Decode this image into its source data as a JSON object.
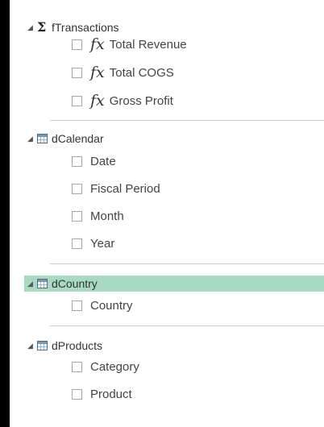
{
  "fields_pane": {
    "tables": [
      {
        "name": "fTransactions",
        "icon": "sigma-icon",
        "fields": [
          {
            "label": "Total Revenue",
            "kind": "measure",
            "icon": "fx-icon"
          },
          {
            "label": "Total COGS",
            "kind": "measure",
            "icon": "fx-icon"
          },
          {
            "label": "Gross Profit",
            "kind": "measure",
            "icon": "fx-icon"
          }
        ]
      },
      {
        "name": "dCalendar",
        "icon": "table-icon",
        "fields": [
          {
            "label": "Date",
            "kind": "column"
          },
          {
            "label": "Fiscal Period",
            "kind": "column"
          },
          {
            "label": "Month",
            "kind": "column"
          },
          {
            "label": "Year",
            "kind": "column"
          }
        ]
      },
      {
        "name": "dCountry",
        "icon": "table-icon",
        "selected": true,
        "fields": [
          {
            "label": "Country",
            "kind": "column"
          }
        ]
      },
      {
        "name": "dProducts",
        "icon": "table-icon",
        "fields": [
          {
            "label": "Category",
            "kind": "column"
          },
          {
            "label": "Product",
            "kind": "column"
          }
        ]
      }
    ],
    "expand_glyph": "◢",
    "sigma_glyph": "Σ",
    "fx_glyph": "fx"
  },
  "colors": {
    "selected_highlight": "#a7dac0",
    "divider": "#cfcfcf",
    "checkbox_border": "#a6a6a6"
  }
}
